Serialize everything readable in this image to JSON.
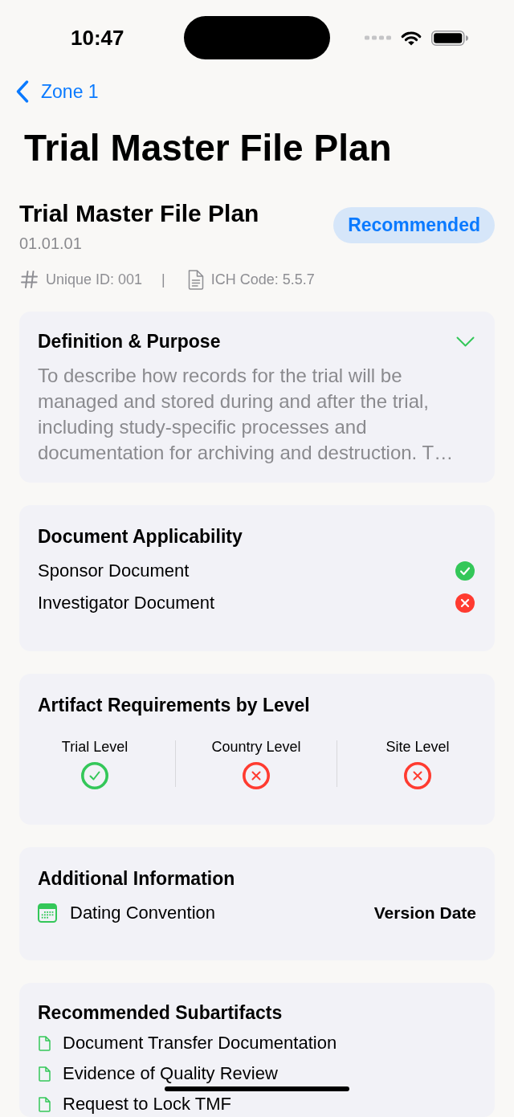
{
  "status_bar": {
    "time": "10:47"
  },
  "navigation": {
    "back_label": "Zone 1",
    "title": "Trial Master File Plan"
  },
  "header": {
    "title": "Trial Master File Plan",
    "number": "01.01.01",
    "badge": "Recommended",
    "unique_id": "Unique ID: 001",
    "separator": "|",
    "ich_code": "ICH Code: 5.5.7"
  },
  "definition": {
    "title": "Definition & Purpose",
    "expanded": false,
    "text": "To describe how records for the trial will be managed and stored during and after the trial, including study-specific processes and documentation for archiving and destruction. T…"
  },
  "applicability": {
    "title": "Document Applicability",
    "items": [
      {
        "label": "Sponsor Document",
        "applicable": true
      },
      {
        "label": "Investigator Document",
        "applicable": false
      }
    ]
  },
  "levels": {
    "title": "Artifact Requirements by Level",
    "items": [
      {
        "label": "Trial Level",
        "required": true
      },
      {
        "label": "Country Level",
        "required": false
      },
      {
        "label": "Site Level",
        "required": false
      }
    ]
  },
  "additional_info": {
    "title": "Additional Information",
    "rows": [
      {
        "label": "Dating Convention",
        "value": "Version Date"
      }
    ]
  },
  "subartifacts": {
    "title": "Recommended Subartifacts",
    "items": [
      {
        "label": "Document Transfer Documentation"
      },
      {
        "label": "Evidence of Quality Review"
      },
      {
        "label": "Request to Lock TMF"
      }
    ]
  }
}
